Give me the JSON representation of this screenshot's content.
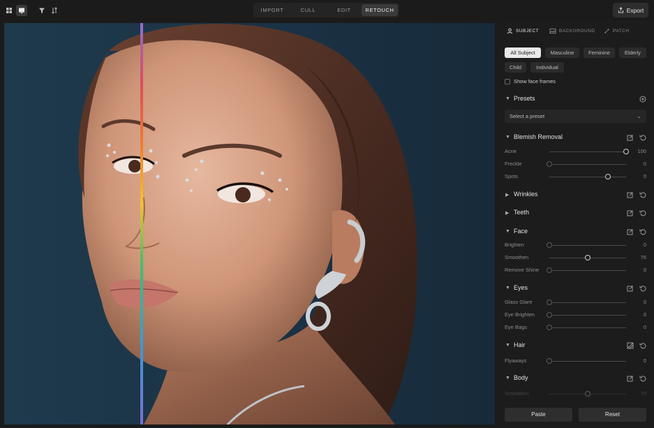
{
  "toolbar": {
    "modes": [
      "IMPORT",
      "CULL",
      "EDIT",
      "RETOUCH"
    ],
    "active_mode": "RETOUCH",
    "export_label": "Export"
  },
  "panel": {
    "subtabs": [
      "SUBJECT",
      "BACKGROUND",
      "PATCH"
    ],
    "chips": [
      "All Subject",
      "Masculine",
      "Feminine",
      "Elderly",
      "Child",
      "Individual"
    ],
    "show_face_frames_label": "Show face frames",
    "presets": {
      "title": "Presets",
      "placeholder": "Select a preset"
    },
    "blemish": {
      "title": "Blemish Removal",
      "sliders": [
        {
          "label": "Acne",
          "value": "100",
          "level": 1.0
        },
        {
          "label": "Freckle",
          "value": "0",
          "level": 0
        },
        {
          "label": "Spots",
          "value": "0",
          "level": 0.76
        }
      ]
    },
    "wrinkles_title": "Wrinkles",
    "teeth_title": "Teeth",
    "face": {
      "title": "Face",
      "sliders": [
        {
          "label": "Brighten",
          "value": "0",
          "level": 0
        },
        {
          "label": "Smoothen",
          "value": "76",
          "level": 0.5
        },
        {
          "label": "Remove Shine",
          "value": "0",
          "level": 0
        }
      ]
    },
    "eyes": {
      "title": "Eyes",
      "sliders": [
        {
          "label": "Glass Glare",
          "value": "0",
          "level": 0
        },
        {
          "label": "Eye Brighten",
          "value": "0",
          "level": 0
        },
        {
          "label": "Eye Bags",
          "value": "0",
          "level": 0
        }
      ]
    },
    "hair": {
      "title": "Hair",
      "sliders": [
        {
          "label": "Flyaways",
          "value": "0",
          "level": 0
        }
      ]
    },
    "body": {
      "title": "Body",
      "sliders": [
        {
          "label": "Smoothen",
          "value": "75",
          "level": 0.5
        }
      ]
    },
    "paste_label": "Paste",
    "reset_label": "Reset"
  },
  "colors": {
    "accent": "#e9e9e9",
    "background": "#1b1b1b",
    "photo_backdrop": "#1e3447"
  }
}
